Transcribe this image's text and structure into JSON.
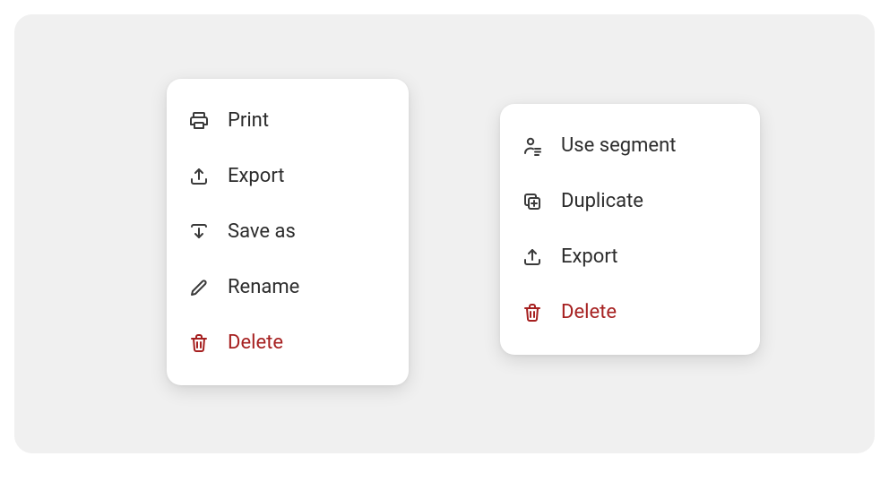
{
  "menus": {
    "a": {
      "items": [
        {
          "label": "Print",
          "icon": "print-icon",
          "danger": false
        },
        {
          "label": "Export",
          "icon": "export-icon",
          "danger": false
        },
        {
          "label": "Save as",
          "icon": "save-as-icon",
          "danger": false
        },
        {
          "label": "Rename",
          "icon": "rename-icon",
          "danger": false
        },
        {
          "label": "Delete",
          "icon": "delete-icon",
          "danger": true
        }
      ]
    },
    "b": {
      "items": [
        {
          "label": "Use segment",
          "icon": "use-segment-icon",
          "danger": false
        },
        {
          "label": "Duplicate",
          "icon": "duplicate-icon",
          "danger": false
        },
        {
          "label": "Export",
          "icon": "export-icon",
          "danger": false
        },
        {
          "label": "Delete",
          "icon": "delete-icon",
          "danger": true
        }
      ]
    }
  },
  "colors": {
    "danger": "#a62020",
    "text": "#2c2c2c",
    "card_bg": "#ffffff",
    "canvas_bg": "#f0f0f0"
  }
}
